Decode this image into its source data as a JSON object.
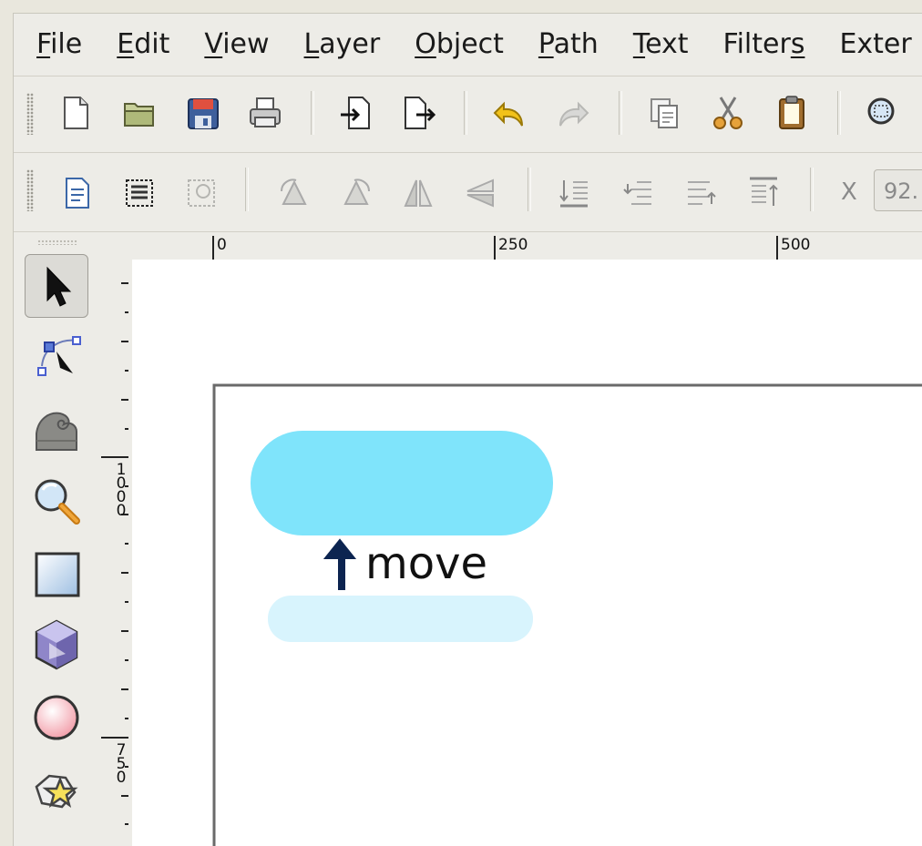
{
  "menu": {
    "items": [
      {
        "pre": "",
        "key": "F",
        "post": "ile"
      },
      {
        "pre": "",
        "key": "E",
        "post": "dit"
      },
      {
        "pre": "",
        "key": "V",
        "post": "iew"
      },
      {
        "pre": "",
        "key": "L",
        "post": "ayer"
      },
      {
        "pre": "",
        "key": "O",
        "post": "bject"
      },
      {
        "pre": "",
        "key": "P",
        "post": "ath"
      },
      {
        "pre": "",
        "key": "T",
        "post": "ext"
      },
      {
        "pre": "Filter",
        "key": "s",
        "post": ""
      },
      {
        "pre": "Exter",
        "key": "",
        "post": ""
      }
    ]
  },
  "toolbar2": {
    "x_label": "X",
    "x_value": "92."
  },
  "ruler": {
    "h_labels": [
      "0",
      "250",
      "500"
    ],
    "v_labels": [
      [
        "1",
        "0",
        "0",
        "0"
      ],
      [
        "7",
        "5",
        "0"
      ]
    ]
  },
  "canvas": {
    "label_text": "move",
    "colors": {
      "pill_top": "#7fe4fb",
      "pill_bottom": "#d8f4fd",
      "arrow": "#0c2450",
      "page_border": "#6a6a6a"
    }
  },
  "toolbox": {
    "tools": [
      "selector-tool",
      "node-tool",
      "tweak-tool",
      "zoom-tool",
      "rect-tool",
      "3dbox-tool",
      "ellipse-tool",
      "star-tool"
    ]
  }
}
